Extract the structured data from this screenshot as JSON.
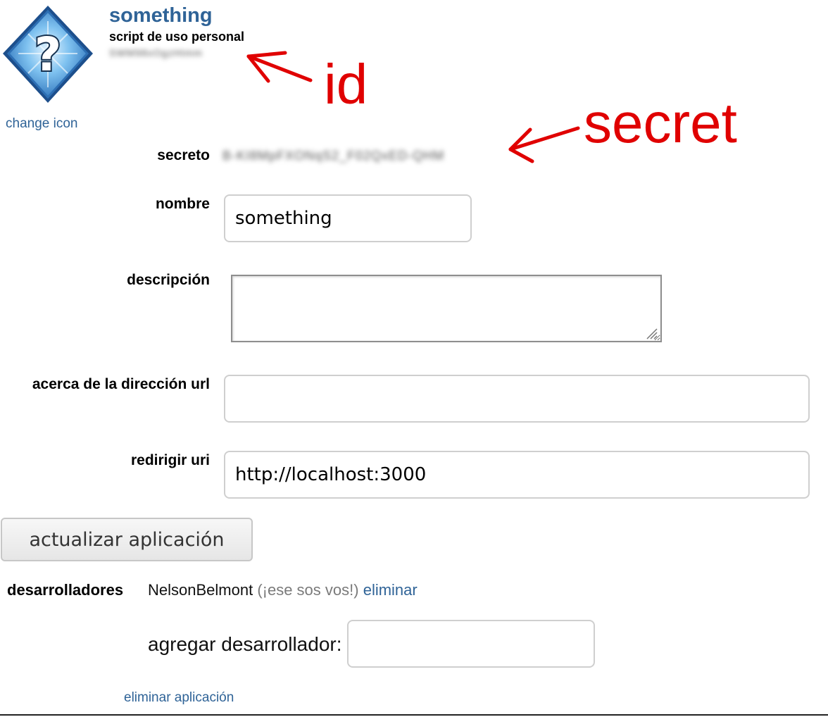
{
  "app": {
    "title": "something",
    "subtitle": "script de uso personal",
    "id_value": "SWM98xOgzHtmm",
    "change_icon_label": "change icon"
  },
  "form": {
    "secret_label": "secreto",
    "secret_value": "B-KI8MpFXONqS2_F02QxED-QHM",
    "name_label": "nombre",
    "name_value": "something",
    "description_label": "descripción",
    "description_value": "",
    "about_url_label": "acerca de la dirección url",
    "about_url_value": "",
    "redirect_uri_label": "redirigir uri",
    "redirect_uri_value": "http://localhost:3000",
    "submit_label": "actualizar aplicación"
  },
  "developers": {
    "label": "desarrolladores",
    "name": "NelsonBelmont",
    "note": "(¡ese sos vos!)",
    "remove_label": "eliminar",
    "add_label": "agregar desarrollador:",
    "add_value": ""
  },
  "delete_app_label": "eliminar aplicación",
  "annotations": {
    "id_label": "id",
    "secret_label": "secret",
    "color": "#e00000"
  },
  "icons": [
    "question-diamond-icon",
    "resize-grip-icon",
    "arrow-icon"
  ]
}
